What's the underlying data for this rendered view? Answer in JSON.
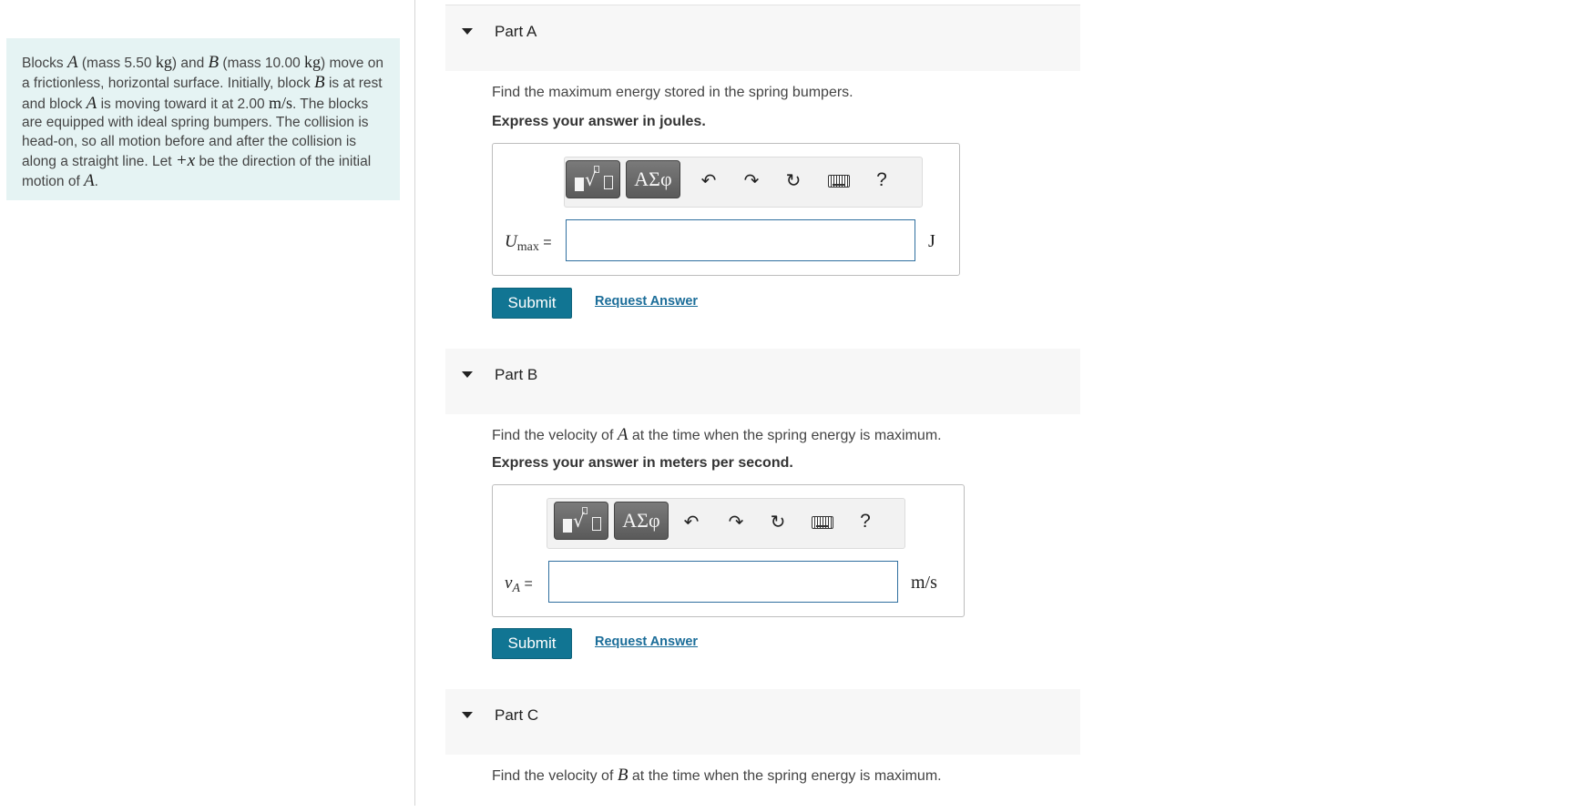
{
  "problem": {
    "t1": "Blocks ",
    "blockA": "A",
    "t2": " (mass 5.50 ",
    "kg": "kg",
    "t3": ") and ",
    "blockB": "B",
    "t4": " (mass 10.00 ",
    "kg2": "kg",
    "t5": ") move on a frictionless, horizontal surface. Initially, block ",
    "blockB2": "B",
    "t6": " is at rest and block ",
    "blockA2": "A",
    "t7": " is moving toward it at 2.00 ",
    "speed_unit": "m/s",
    "t8": ". The blocks are equipped with ideal spring bumpers. The collision is head-on, so all motion before and after the collision is along a straight line. Let ",
    "direction": "+x",
    "t9": " be the direction of the initial motion of ",
    "blockA3": "A",
    "t10": "."
  },
  "toolbar": {
    "greek_label": "ΑΣφ",
    "help_label": "?"
  },
  "parts": {
    "a": {
      "title": "Part A",
      "prompt": "Find the maximum energy stored in the spring bumpers.",
      "express": "Express your answer in joules.",
      "var": "U",
      "var_sub": "max",
      "eq": " =",
      "value": "",
      "unit": "J",
      "submit": "Submit",
      "request": "Request Answer"
    },
    "b": {
      "title": "Part B",
      "prompt_pre": "Find the velocity of ",
      "prompt_var": "A",
      "prompt_post": " at the time when the spring energy is maximum.",
      "express": "Express your answer in meters per second.",
      "var": "v",
      "var_sub": "A",
      "eq": " =",
      "value": "",
      "unit": "m/s",
      "submit": "Submit",
      "request": "Request Answer"
    },
    "c": {
      "title": "Part C",
      "prompt_pre": "Find the velocity of ",
      "prompt_var": "B",
      "prompt_post": " at the time when the spring energy is maximum."
    }
  },
  "icons": [
    "undo-icon",
    "redo-icon",
    "reset-icon",
    "keyboard-icon",
    "help-icon"
  ]
}
